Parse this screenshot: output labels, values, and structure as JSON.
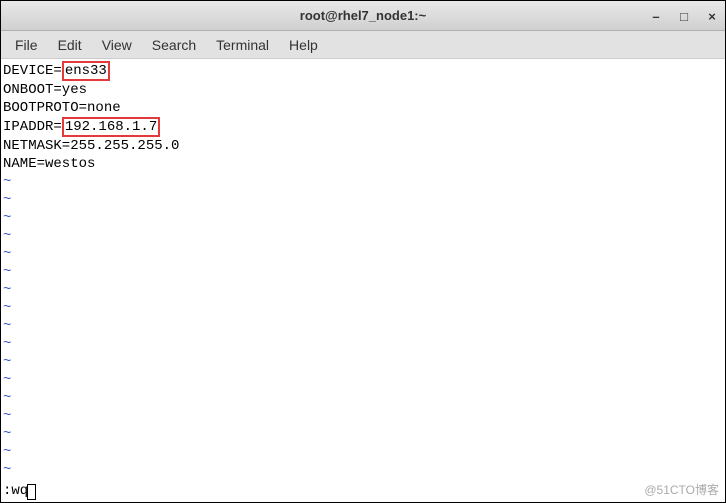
{
  "window": {
    "title": "root@rhel7_node1:~"
  },
  "menubar": {
    "file": "File",
    "edit": "Edit",
    "view": "View",
    "search": "Search",
    "terminal": "Terminal",
    "help": "Help"
  },
  "content": {
    "line1_key": "DEVICE=",
    "line1_val": "ens33",
    "line2": "ONBOOT=yes",
    "line3": "BOOTPROTO=none",
    "line4_key": "IPADDR=",
    "line4_val": "192.168.1.7",
    "line5": "NETMASK=255.255.255.0",
    "line6": "NAME=westos",
    "tilde": "~"
  },
  "status": {
    "command": ":wq"
  },
  "watermark": "@51CTO博客",
  "highlights": {
    "color": "#e33b3b"
  },
  "window_controls": {
    "minimize": "–",
    "maximize": "□",
    "close": "×"
  }
}
